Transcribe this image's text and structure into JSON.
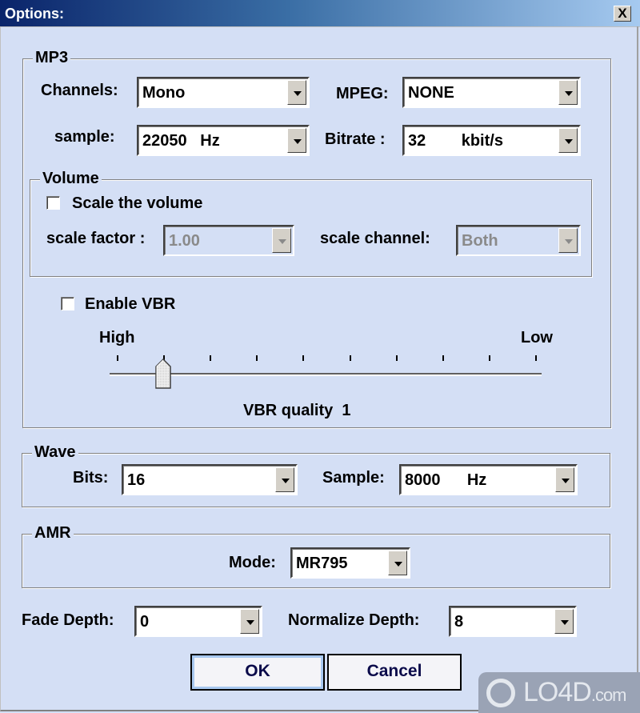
{
  "window": {
    "title": "Options:",
    "close_glyph": "X"
  },
  "mp3": {
    "legend": "MP3",
    "channels": {
      "label": "Channels:",
      "value": "Mono"
    },
    "mpeg": {
      "label": "MPEG:",
      "value": "NONE"
    },
    "sample": {
      "label": "sample:",
      "value": "22050   Hz"
    },
    "bitrate": {
      "label": "Bitrate :",
      "value": "32        kbit/s"
    },
    "volume": {
      "legend": "Volume",
      "scale_checkbox": {
        "label": "Scale the volume",
        "checked": false
      },
      "scale_factor": {
        "label": "scale factor :",
        "value": "1.00",
        "disabled": true
      },
      "scale_channel": {
        "label": "scale channel:",
        "value": "Both",
        "disabled": true
      }
    },
    "vbr": {
      "enable_checkbox": {
        "label": "Enable VBR",
        "checked": false
      },
      "high_label": "High",
      "low_label": "Low",
      "slider": {
        "min": 0,
        "max": 9,
        "value": 1
      },
      "quality_text": "VBR quality  1"
    }
  },
  "wave": {
    "legend": "Wave",
    "bits": {
      "label": "Bits:",
      "value": "16"
    },
    "sample": {
      "label": "Sample:",
      "value": "8000      Hz"
    }
  },
  "amr": {
    "legend": "AMR",
    "mode": {
      "label": "Mode:",
      "value": "MR795"
    }
  },
  "fade_depth": {
    "label": "Fade Depth:",
    "value": "0"
  },
  "normalize_depth": {
    "label": "Normalize Depth:",
    "value": "8"
  },
  "buttons": {
    "ok": "OK",
    "cancel": "Cancel"
  },
  "watermark": {
    "brand": "LO4D",
    "suffix": ".com"
  }
}
